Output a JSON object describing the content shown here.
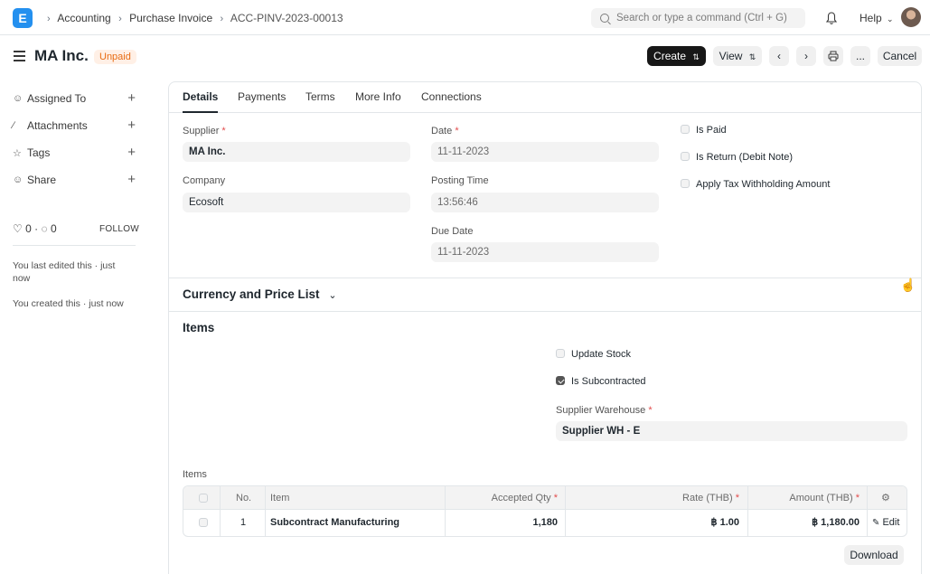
{
  "navbar": {
    "logo_letter": "E",
    "breadcrumbs": [
      "Accounting",
      "Purchase Invoice",
      "ACC-PINV-2023-00013"
    ],
    "search_placeholder": "Search or type a command (Ctrl + G)",
    "help_label": "Help"
  },
  "page": {
    "title": "MA Inc.",
    "status": "Unpaid",
    "buttons": {
      "create": "Create",
      "view": "View",
      "cancel": "Cancel",
      "more": "..."
    }
  },
  "sidebar": {
    "items": [
      {
        "label": "Assigned To",
        "icon": "user-check-icon"
      },
      {
        "label": "Attachments",
        "icon": "paperclip-icon"
      },
      {
        "label": "Tags",
        "icon": "tag-icon"
      },
      {
        "label": "Share",
        "icon": "share-user-icon"
      }
    ],
    "likes": "0",
    "comments": "0",
    "follow": "FOLLOW",
    "edited_note": "You last edited this · just now",
    "created_note": "You created this · just now"
  },
  "tabs": [
    "Details",
    "Payments",
    "Terms",
    "More Info",
    "Connections"
  ],
  "details": {
    "supplier_label": "Supplier",
    "supplier_value": "MA Inc.",
    "company_label": "Company",
    "company_value": "Ecosoft",
    "date_label": "Date",
    "date_value": "11-11-2023",
    "posting_time_label": "Posting Time",
    "posting_time_value": "13:56:46",
    "due_date_label": "Due Date",
    "due_date_value": "11-11-2023",
    "is_paid_label": "Is Paid",
    "is_return_label": "Is Return (Debit Note)",
    "apply_tax_label": "Apply Tax Withholding Amount"
  },
  "currency_section": {
    "title": "Currency and Price List"
  },
  "items_section": {
    "title": "Items",
    "update_stock_label": "Update Stock",
    "is_subcontracted_label": "Is Subcontracted",
    "supplier_warehouse_label": "Supplier Warehouse",
    "supplier_warehouse_value": "Supplier WH - E",
    "table_label": "Items",
    "columns": {
      "no": "No.",
      "item": "Item",
      "accepted_qty": "Accepted Qty",
      "rate": "Rate (THB)",
      "amount": "Amount (THB)"
    },
    "rows": [
      {
        "no": "1",
        "item": "Subcontract Manufacturing",
        "accepted_qty": "1,180",
        "rate": "฿ 1.00",
        "amount": "฿ 1,180.00",
        "edit": "Edit"
      }
    ],
    "download_label": "Download"
  }
}
